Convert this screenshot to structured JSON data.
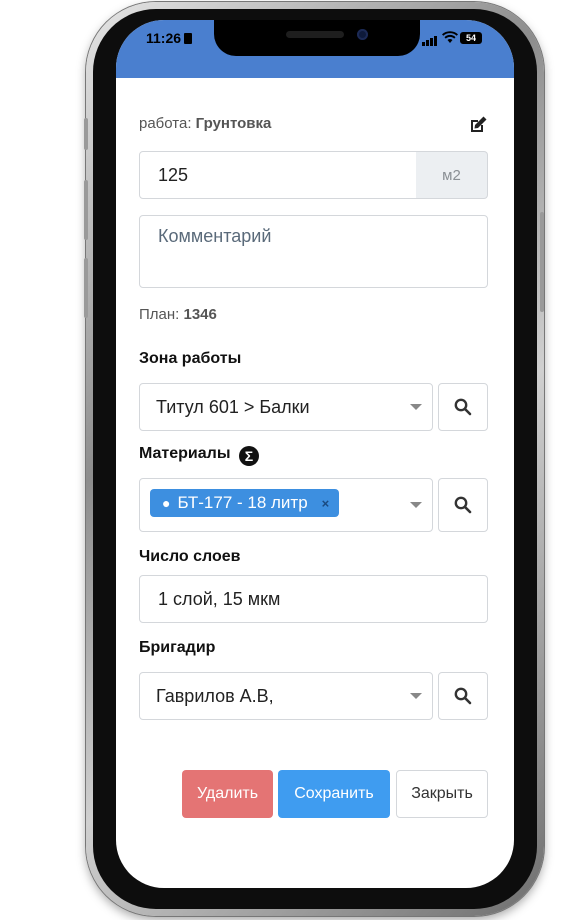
{
  "status_bar": {
    "time": "11:26",
    "battery": "54"
  },
  "form": {
    "work_prefix": "работа:",
    "work_name": "Грунтовка",
    "quantity_value": "125",
    "quantity_unit": "м2",
    "comment_placeholder": "Комментарий",
    "plan_prefix": "План:",
    "plan_value": "1346",
    "zone_label": "Зона работы",
    "zone_value": "Титул 601 > Балки",
    "materials_label": "Материалы",
    "materials_chip": "БТ-177 - 18 литр",
    "materials_chip_remove": "×",
    "layers_label": "Число слоев",
    "layers_value": "1 слой, 15 мкм",
    "foreman_label": "Бригадир",
    "foreman_value": "Гаврилов А.В,"
  },
  "buttons": {
    "delete": "Удалить",
    "save": "Сохранить",
    "close": "Закрыть"
  },
  "icons": {
    "edit": "edit-icon",
    "search": "search-icon",
    "sigma": "Σ"
  },
  "colors": {
    "header": "#4a7fcf",
    "delete": "#e47474",
    "save": "#3f9cf0",
    "chip": "#3d8fe0"
  }
}
